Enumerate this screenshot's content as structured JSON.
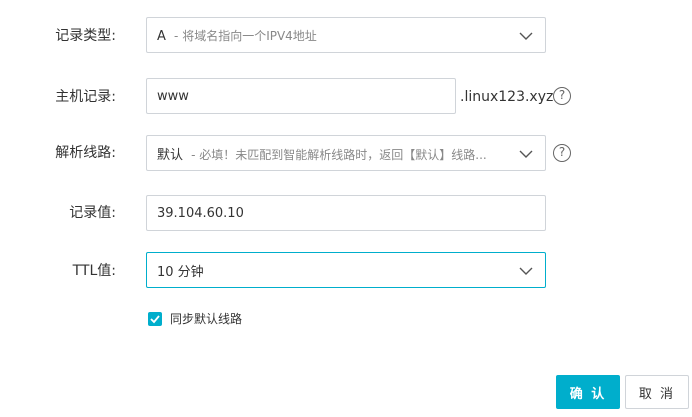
{
  "form": {
    "record_type": {
      "label": "记录类型:",
      "value_main": "A",
      "value_hint": "- 将域名指向一个IPV4地址"
    },
    "host": {
      "label": "主机记录:",
      "value": "www",
      "suffix": ".linux123.xyz"
    },
    "line": {
      "label": "解析线路:",
      "value_main": "默认",
      "value_hint": "- 必填！未匹配到智能解析线路时，返回【默认】线路..."
    },
    "record_value": {
      "label": "记录值:",
      "value": "39.104.60.10"
    },
    "ttl": {
      "label": "TTL值:",
      "value": "10 分钟"
    },
    "sync_default": {
      "label": "同步默认线路",
      "checked": true
    },
    "help_glyph": "?"
  },
  "actions": {
    "confirm_label": "确 认",
    "cancel_label": "取 消"
  },
  "colors": {
    "accent": "#00aecc",
    "border": "#d0d4d9",
    "text": "#333333"
  },
  "icons": [
    "chevron-down-icon",
    "help-icon",
    "checkmark-icon"
  ]
}
